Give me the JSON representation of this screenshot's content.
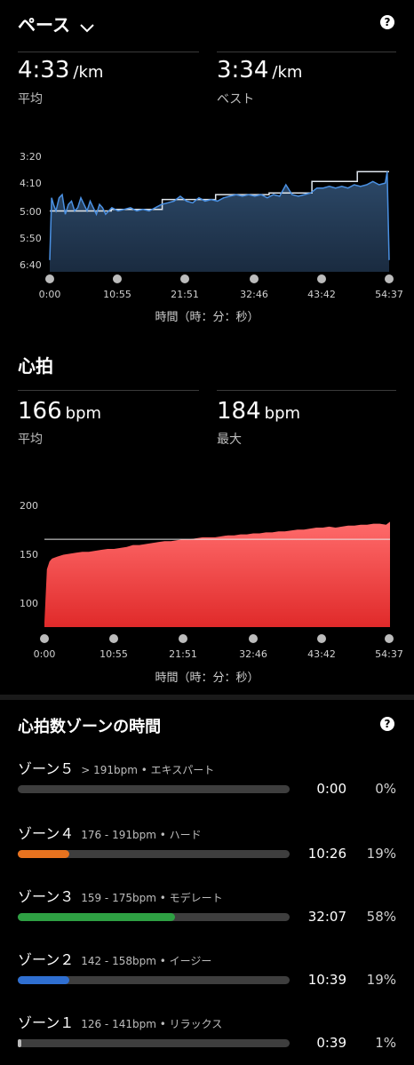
{
  "pace": {
    "title": "ペース",
    "avg": {
      "value": "4:33",
      "unit": "/km",
      "label": "平均"
    },
    "best": {
      "value": "3:34",
      "unit": "/km",
      "label": "ベスト"
    },
    "y_ticks": [
      "3:20",
      "4:10",
      "5:00",
      "5:50",
      "6:40"
    ],
    "x_ticks": [
      "0:00",
      "10:55",
      "21:51",
      "32:46",
      "43:42",
      "54:37"
    ],
    "axis_title": "時間（時：分：秒）"
  },
  "heart": {
    "title": "心拍",
    "avg": {
      "value": "166",
      "unit": "bpm",
      "label": "平均"
    },
    "max": {
      "value": "184",
      "unit": "bpm",
      "label": "最大"
    },
    "y_ticks": [
      "200",
      "150",
      "100"
    ],
    "x_ticks": [
      "0:00",
      "10:55",
      "21:51",
      "32:46",
      "43:42",
      "54:37"
    ],
    "axis_title": "時間（時：分：秒）"
  },
  "zones": {
    "title": "心拍数ゾーンの時間",
    "items": [
      {
        "name": "ゾーン５",
        "range": "> 191bpm • エキスパート",
        "time": "0:00",
        "pct": "0%",
        "fraction": 0.0,
        "color": "#555555"
      },
      {
        "name": "ゾーン４",
        "range": "176 - 191bpm • ハード",
        "time": "10:26",
        "pct": "19%",
        "fraction": 0.19,
        "color": "#e8731f"
      },
      {
        "name": "ゾーン３",
        "range": "159 - 175bpm • モデレート",
        "time": "32:07",
        "pct": "58%",
        "fraction": 0.58,
        "color": "#2ea043"
      },
      {
        "name": "ゾーン２",
        "range": "142 - 158bpm • イージー",
        "time": "10:39",
        "pct": "19%",
        "fraction": 0.19,
        "color": "#2f6fd1"
      },
      {
        "name": "ゾーン１",
        "range": "126 - 141bpm • リラックス",
        "time": "0:39",
        "pct": "1%",
        "fraction": 0.01,
        "color": "#bbbbbb"
      }
    ]
  },
  "chart_data": [
    {
      "type": "line",
      "ylabel": "",
      "xlabel": "時間（時：分：秒）",
      "y_unit": "min/km",
      "y_inverted": true,
      "ylim": [
        6.5,
        3.1
      ],
      "xlim": [
        0,
        54.62
      ],
      "x": [
        0,
        0.3,
        0.6,
        1,
        1.5,
        2,
        2.5,
        3,
        3.5,
        4,
        4.5,
        5,
        5.5,
        6,
        6.5,
        7,
        7.5,
        8,
        8.5,
        9,
        9.5,
        10,
        11,
        12,
        13,
        14,
        15,
        16,
        17,
        18,
        19,
        20,
        21,
        22,
        23,
        24,
        25,
        26,
        27,
        28,
        29,
        30,
        31,
        32,
        33,
        34,
        35,
        36,
        37,
        38,
        39,
        40,
        41,
        42,
        43,
        44,
        45,
        46,
        47,
        48,
        49,
        50,
        51,
        52,
        53,
        54,
        54.3,
        54.62
      ],
      "pace": [
        6.5,
        4.6,
        4.8,
        5.0,
        4.6,
        4.5,
        5.1,
        4.8,
        4.7,
        5.0,
        4.9,
        4.6,
        4.8,
        5.0,
        4.7,
        4.9,
        5.1,
        4.8,
        4.9,
        5.1,
        5.0,
        4.9,
        5.0,
        4.95,
        4.9,
        5.0,
        4.95,
        5.0,
        4.9,
        4.8,
        4.75,
        4.7,
        4.55,
        4.7,
        4.75,
        4.6,
        4.7,
        4.65,
        4.7,
        4.6,
        4.55,
        4.5,
        4.55,
        4.5,
        4.55,
        4.5,
        4.6,
        4.5,
        4.55,
        4.2,
        4.5,
        4.55,
        4.5,
        4.45,
        4.3,
        4.3,
        4.25,
        4.3,
        4.25,
        4.3,
        4.2,
        4.25,
        4.2,
        4.1,
        4.2,
        4.15,
        3.8,
        6.5
      ],
      "split_pace": [
        {
          "from": 0,
          "to": 9.9,
          "pace": 5.0
        },
        {
          "from": 9.9,
          "to": 18.1,
          "pace": 4.95
        },
        {
          "from": 18.1,
          "to": 26.7,
          "pace": 4.65
        },
        {
          "from": 26.7,
          "to": 35.3,
          "pace": 4.5
        },
        {
          "from": 35.3,
          "to": 42.2,
          "pace": 4.45
        },
        {
          "from": 42.2,
          "to": 49.5,
          "pace": 4.1
        },
        {
          "from": 49.5,
          "to": 54.62,
          "pace": 3.8
        }
      ]
    },
    {
      "type": "area",
      "ylabel": "",
      "xlabel": "時間（時：分：秒）",
      "y_unit": "bpm",
      "ylim": [
        78,
        205
      ],
      "xlim": [
        0,
        54.62
      ],
      "avg_line": 166,
      "x": [
        0,
        0.4,
        0.8,
        1.2,
        2,
        3,
        4,
        5,
        6,
        7,
        8,
        9,
        10,
        11,
        12,
        13,
        14,
        15,
        16,
        17,
        18,
        19,
        20,
        21,
        22,
        23,
        24,
        25,
        26,
        27,
        28,
        29,
        30,
        31,
        32,
        33,
        34,
        35,
        36,
        37,
        38,
        39,
        40,
        41,
        42,
        43,
        44,
        45,
        46,
        47,
        48,
        49,
        50,
        51,
        52,
        53,
        54,
        54.62
      ],
      "values": [
        80,
        135,
        143,
        146,
        148,
        150,
        151,
        152,
        153,
        153,
        154,
        155,
        156,
        156,
        157,
        158,
        160,
        160,
        161,
        162,
        163,
        164,
        164,
        165,
        166,
        166,
        167,
        168,
        168,
        168,
        169,
        170,
        170,
        171,
        171,
        172,
        172,
        173,
        173,
        174,
        174,
        175,
        176,
        176,
        177,
        178,
        178,
        179,
        178,
        179,
        180,
        180,
        181,
        181,
        182,
        182,
        181,
        184
      ]
    }
  ]
}
